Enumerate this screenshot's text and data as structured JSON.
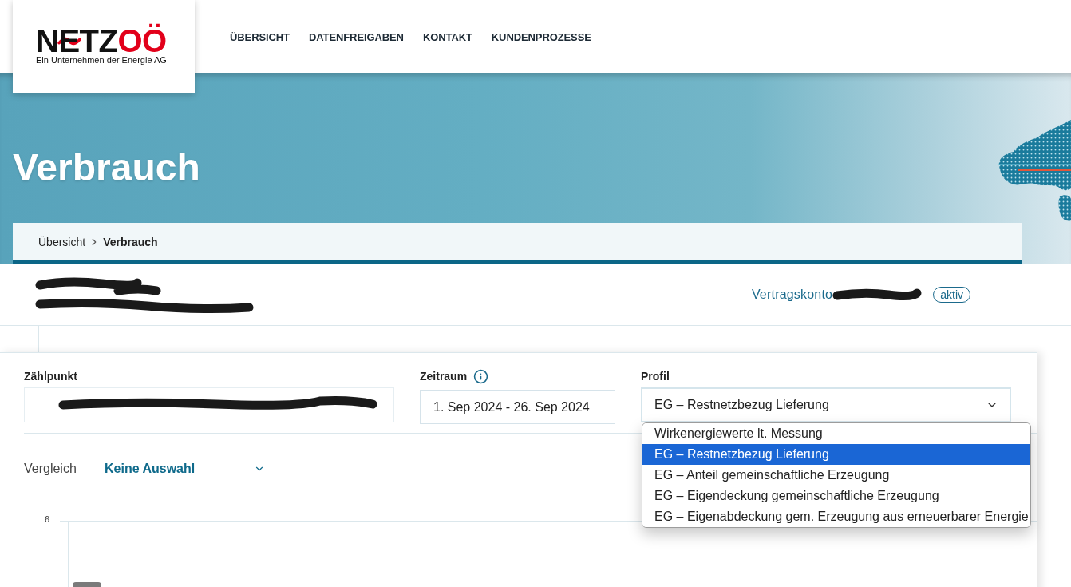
{
  "header": {
    "logo": {
      "wordmark": "NETZ",
      "wordmark_accent": "OÖ",
      "tagline": "Ein Unternehmen der Energie AG"
    },
    "nav": [
      "ÜBERSICHT",
      "DATENFREIGABEN",
      "KONTAKT",
      "KUNDENPROZESSE"
    ]
  },
  "banner": {
    "title": "Verbrauch",
    "breadcrumb": [
      {
        "label": "Übersicht",
        "current": false
      },
      {
        "label": "Verbrauch",
        "current": true
      }
    ]
  },
  "customer": {
    "name_redacted": true,
    "address_redacted": true
  },
  "account": {
    "label": "Vertragskonto",
    "number_redacted": true,
    "status": "aktiv"
  },
  "filters": {
    "meter_point": {
      "label": "Zählpunkt",
      "value_redacted": true
    },
    "period": {
      "label": "Zeitraum",
      "value": "1. Sep 2024 - 26. Sep 2024"
    },
    "profile": {
      "label": "Profil",
      "value": "EG – Restnetzbezug Lieferung",
      "expanded": true,
      "options": [
        {
          "label": "Wirkenergiewerte lt. Messung",
          "selected": false
        },
        {
          "label": "EG – Restnetzbezug Lieferung",
          "selected": true
        },
        {
          "label": "EG – Anteil gemeinschaftliche Erzeugung",
          "selected": false
        },
        {
          "label": "EG – Eigendeckung gemeinschaftliche Erzeugung",
          "selected": false
        },
        {
          "label": "EG – Eigenabdeckung gem. Erzeugung aus erneuerbarer Energie",
          "selected": false
        }
      ]
    }
  },
  "comparison": {
    "label": "Vergleich",
    "value": "Keine Auswahl"
  },
  "chart": {
    "y_ticks": [
      "6"
    ]
  }
}
